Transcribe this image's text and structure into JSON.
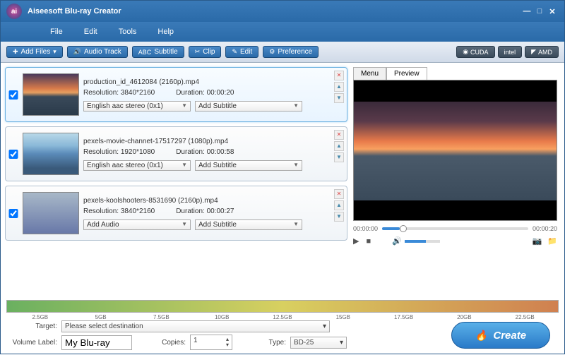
{
  "window": {
    "title": "Aiseesoft Blu-ray Creator"
  },
  "menu": [
    "File",
    "Edit",
    "Tools",
    "Help"
  ],
  "toolbar": {
    "add_files": "Add Files",
    "audio_track": "Audio Track",
    "subtitle": "Subtitle",
    "clip": "Clip",
    "edit": "Edit",
    "preference": "Preference"
  },
  "gpu": {
    "cuda": "CUDA",
    "intel": "intel",
    "amd": "AMD"
  },
  "files": [
    {
      "name": "production_id_4612084 (2160p).mp4",
      "res_label": "Resolution:",
      "res": "3840*2160",
      "dur_label": "Duration:",
      "dur": "00:00:20",
      "audio": "English aac stereo (0x1)",
      "subtitle": "Add Subtitle",
      "selected": true
    },
    {
      "name": "pexels-movie-channet-17517297 (1080p).mp4",
      "res_label": "Resolution:",
      "res": "1920*1080",
      "dur_label": "Duration:",
      "dur": "00:00:58",
      "audio": "English aac stereo (0x1)",
      "subtitle": "Add Subtitle",
      "selected": false
    },
    {
      "name": "pexels-koolshooters-8531690 (2160p).mp4",
      "res_label": "Resolution:",
      "res": "3840*2160",
      "dur_label": "Duration:",
      "dur": "00:00:27",
      "audio": "Add Audio",
      "subtitle": "Add Subtitle",
      "selected": false
    }
  ],
  "tabs": {
    "menu": "Menu",
    "preview": "Preview"
  },
  "timeline": {
    "start": "00:00:00",
    "end": "00:00:20"
  },
  "size_ticks": [
    "2.5GB",
    "5GB",
    "7.5GB",
    "10GB",
    "12.5GB",
    "15GB",
    "17.5GB",
    "20GB",
    "22.5GB"
  ],
  "bottom": {
    "target_label": "Target:",
    "target": "Please select destination",
    "volume_label": "Volume Label:",
    "volume": "My Blu-ray",
    "copies_label": "Copies:",
    "copies": "1",
    "type_label": "Type:",
    "type": "BD-25",
    "create": "Create"
  }
}
